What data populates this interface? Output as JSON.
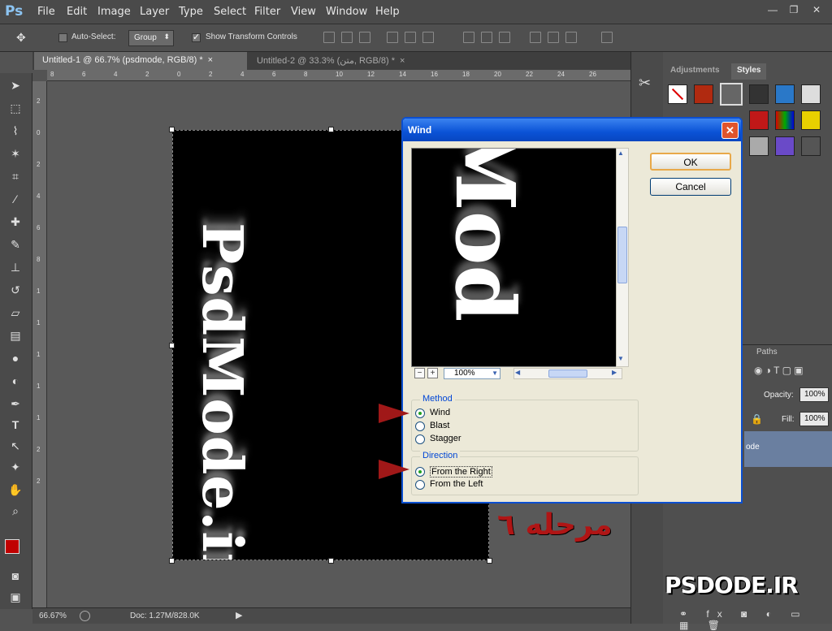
{
  "app": {
    "logo": "Ps"
  },
  "menu": [
    "File",
    "Edit",
    "Image",
    "Layer",
    "Type",
    "Select",
    "Filter",
    "View",
    "Window",
    "Help"
  ],
  "window_controls": {
    "minimize": "—",
    "restore": "❐",
    "close": "✕"
  },
  "options": {
    "auto_select_label": "Auto-Select:",
    "group_value": "Group",
    "transform_label": "Show Transform Controls"
  },
  "tabs": [
    {
      "label": "Untitled-1 @ 66.7% (psdmode, RGB/8) *"
    },
    {
      "label": "Untitled-2 @ 33.3% (متن, RGB/8) *"
    }
  ],
  "ruler_h": [
    "8",
    "6",
    "4",
    "2",
    "0",
    "2",
    "4",
    "6",
    "8",
    "10",
    "12",
    "14",
    "16",
    "18",
    "20",
    "22",
    "24",
    "26"
  ],
  "ruler_v": [
    "2",
    "0",
    "2",
    "4",
    "6",
    "8",
    "1",
    "1",
    "1",
    "1",
    "1",
    "2",
    "2"
  ],
  "canvas": {
    "text": "PsdMode.ir"
  },
  "status": {
    "zoom": "66.67%",
    "doc": "Doc: 1.27M/828.0K"
  },
  "panels": {
    "adjustments_tab": "Adjustments",
    "styles_tab": "Styles",
    "paths_tab": "Paths",
    "opacity_label": "Opacity:",
    "opacity_value": "100%",
    "fill_label": "Fill:",
    "fill_value": "100%",
    "layer_name_fragment": "ode"
  },
  "dialog": {
    "title": "Wind",
    "ok": "OK",
    "cancel": "Cancel",
    "preview_text": "Mod",
    "zoom": "100%",
    "method": {
      "title": "Method",
      "options": [
        "Wind",
        "Blast",
        "Stagger"
      ],
      "selected": "Wind"
    },
    "direction": {
      "title": "Direction",
      "options": [
        "From the Right",
        "From the Left"
      ],
      "selected": "From the Right"
    }
  },
  "overlay": {
    "step": "مرحله ٦",
    "watermark": "PSDODE.IR"
  },
  "colors": {
    "foreground": "#c00000",
    "background": "#ffffff",
    "arrow": "#a01818",
    "dialog_title": "#0a52d6"
  }
}
